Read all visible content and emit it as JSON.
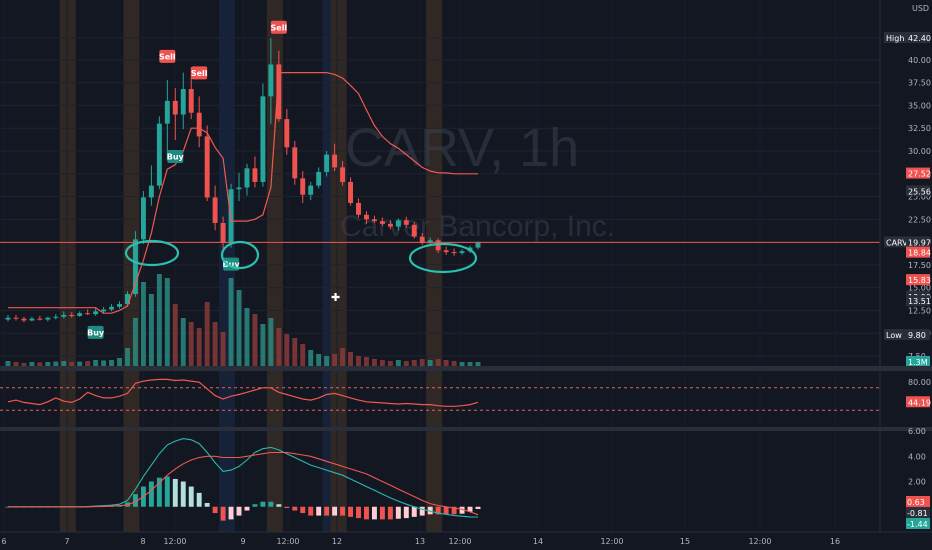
{
  "corner_label": "USD",
  "crosshair_glyph": "✚",
  "watermark": {
    "title": "CARV, 1h",
    "subtitle": "Carver Bancorp, Inc."
  },
  "colors": {
    "background": "#131722",
    "up": "#26a69a",
    "down": "#ef5350",
    "volume_up": "#2a8a80",
    "volume_down": "#8a3a38",
    "supertrend": "#f0584f",
    "rsi": "#f0584f",
    "macd": "#2ab7b0",
    "signal": "#f0584f",
    "hist_up_strong": "#26a69a",
    "hist_up_weak": "#b2dfdb",
    "hist_down_strong": "#ef5350",
    "hist_down_weak": "#ffcdd2",
    "annotation": "#2bbfae",
    "session_orange": "#f59c3a",
    "session_blue": "#2d6bd1"
  },
  "price_axis_labels": [
    "42.40",
    "40.00",
    "37.50",
    "35.00",
    "32.50",
    "30.00",
    "27.50",
    "25.00",
    "22.50",
    "20.00",
    "17.50",
    "15.00",
    "12.50",
    "10.00",
    "7.50"
  ],
  "price_tags": [
    {
      "text": "High",
      "value": "42.40",
      "style": "dark"
    },
    {
      "text": "",
      "value": "27.52",
      "style": "red"
    },
    {
      "text": "",
      "value": "25.56",
      "style": "dark"
    },
    {
      "text": "CARV",
      "value": "19.97",
      "style": "dark"
    },
    {
      "text": "",
      "value": "18.84",
      "style": "red"
    },
    {
      "text": "",
      "value": "15.83",
      "style": "red"
    },
    {
      "text": "",
      "value": "13.99",
      "style": "dark"
    },
    {
      "text": "",
      "value": "13.51",
      "style": "dark"
    },
    {
      "text": "Low",
      "value": "9.80",
      "style": "dark"
    },
    {
      "text": "",
      "value": "1.3M",
      "style": "teal"
    }
  ],
  "rsi_axis_labels": [
    "80.00"
  ],
  "rsi_tag": "44.19",
  "macd_axis_labels": [
    "6.00",
    "4.00",
    "2.00"
  ],
  "macd_tags": [
    {
      "value": "0.63",
      "style": "red"
    },
    {
      "value": "-0.81",
      "style": "dark"
    },
    {
      "value": "-1.44",
      "style": "teal"
    }
  ],
  "time_axis_labels": [
    "6",
    "7",
    "8",
    "12:00",
    "9",
    "12:00",
    "12",
    "13",
    "12:00",
    "14",
    "12:00",
    "15",
    "12:00",
    "16"
  ],
  "signals": [
    {
      "type": "Sell",
      "bar": 20
    },
    {
      "type": "Sell",
      "bar": 24
    },
    {
      "type": "Sell",
      "bar": 34
    },
    {
      "type": "Buy",
      "bar": 11
    },
    {
      "type": "Buy",
      "bar": 21
    },
    {
      "type": "Buy",
      "bar": 28
    }
  ],
  "chart_data": [
    {
      "type": "candlestick",
      "title": "CARV, 1h",
      "subtitle": "Carver Bancorp, Inc.",
      "currency": "USD",
      "ylim": [
        7.5,
        42.4
      ],
      "x": [
        "6",
        "7",
        "8",
        "12:00",
        "9",
        "12:00",
        "12",
        "13",
        "12:00",
        "14",
        "12:00",
        "15",
        "12:00",
        "16"
      ],
      "ohlc": [
        [
          11.5,
          12.0,
          11.3,
          11.7
        ],
        [
          11.7,
          12.0,
          11.4,
          11.6
        ],
        [
          11.6,
          11.8,
          11.2,
          11.4
        ],
        [
          11.4,
          11.8,
          11.3,
          11.6
        ],
        [
          11.6,
          11.9,
          11.4,
          11.5
        ],
        [
          11.5,
          11.8,
          11.3,
          11.7
        ],
        [
          11.7,
          12.1,
          11.5,
          11.8
        ],
        [
          11.8,
          12.4,
          11.6,
          12.0
        ],
        [
          12.0,
          12.3,
          11.7,
          11.9
        ],
        [
          11.9,
          12.4,
          11.8,
          12.2
        ],
        [
          12.2,
          12.6,
          12.0,
          12.1
        ],
        [
          12.1,
          12.8,
          11.9,
          12.4
        ],
        [
          12.4,
          12.9,
          12.1,
          12.6
        ],
        [
          12.6,
          13.2,
          12.4,
          12.9
        ],
        [
          12.9,
          13.5,
          12.7,
          13.2
        ],
        [
          13.2,
          14.6,
          12.9,
          14.3
        ],
        [
          14.3,
          21.2,
          14.0,
          20.3
        ],
        [
          20.3,
          25.6,
          19.8,
          24.9
        ],
        [
          24.9,
          28.4,
          24.0,
          26.2
        ],
        [
          26.2,
          33.8,
          25.8,
          33.0
        ],
        [
          33.0,
          37.8,
          29.0,
          35.5
        ],
        [
          35.5,
          36.9,
          31.2,
          34.0
        ],
        [
          34.0,
          38.6,
          32.4,
          36.8
        ],
        [
          36.8,
          39.2,
          33.5,
          34.2
        ],
        [
          34.2,
          36.0,
          30.4,
          31.6
        ],
        [
          31.6,
          32.8,
          24.5,
          24.9
        ],
        [
          24.9,
          26.2,
          21.3,
          22.1
        ],
        [
          22.1,
          22.8,
          19.3,
          19.9
        ],
        [
          19.9,
          26.4,
          19.4,
          25.8
        ],
        [
          25.8,
          27.6,
          24.5,
          26.0
        ],
        [
          26.0,
          28.6,
          25.1,
          28.1
        ],
        [
          28.1,
          29.4,
          26.0,
          26.6
        ],
        [
          26.6,
          37.4,
          26.1,
          36.0
        ],
        [
          36.0,
          42.4,
          33.0,
          39.5
        ],
        [
          39.5,
          41.0,
          33.2,
          33.5
        ],
        [
          33.5,
          34.6,
          29.6,
          30.4
        ],
        [
          30.4,
          31.1,
          26.3,
          27.0
        ],
        [
          27.0,
          27.8,
          24.3,
          25.2
        ],
        [
          25.2,
          26.6,
          24.6,
          26.2
        ],
        [
          26.2,
          28.2,
          25.9,
          27.7
        ],
        [
          27.7,
          30.0,
          27.2,
          29.6
        ],
        [
          29.6,
          30.8,
          27.8,
          28.2
        ],
        [
          28.2,
          28.9,
          26.2,
          26.6
        ],
        [
          26.6,
          27.1,
          24.0,
          24.3
        ],
        [
          24.3,
          24.8,
          22.7,
          23.0
        ],
        [
          23.0,
          23.4,
          22.0,
          22.5
        ],
        [
          22.5,
          22.9,
          22.1,
          22.3
        ],
        [
          22.3,
          22.7,
          21.8,
          22.0
        ],
        [
          22.0,
          22.4,
          21.4,
          21.7
        ],
        [
          21.7,
          22.6,
          21.3,
          22.4
        ],
        [
          22.4,
          22.8,
          21.6,
          21.9
        ],
        [
          21.9,
          22.2,
          20.4,
          20.6
        ],
        [
          20.6,
          21.0,
          19.7,
          19.9
        ],
        [
          19.9,
          20.5,
          19.6,
          20.2
        ],
        [
          20.2,
          20.4,
          18.8,
          19.1
        ],
        [
          19.1,
          19.5,
          18.6,
          18.9
        ],
        [
          18.9,
          19.3,
          18.5,
          18.8
        ],
        [
          18.8,
          19.2,
          18.6,
          19.0
        ],
        [
          19.0,
          19.6,
          18.8,
          19.4
        ],
        [
          19.4,
          20.1,
          19.2,
          19.97
        ]
      ],
      "volume": [
        0.25,
        0.2,
        0.15,
        0.2,
        0.18,
        0.2,
        0.22,
        0.25,
        0.2,
        0.22,
        0.25,
        0.3,
        0.28,
        0.3,
        0.4,
        0.9,
        2.4,
        4.2,
        3.6,
        4.6,
        4.4,
        3.1,
        2.4,
        2.2,
        1.9,
        3.2,
        2.2,
        1.7,
        4.4,
        3.8,
        2.9,
        2.6,
        2.1,
        2.4,
        1.9,
        1.6,
        1.4,
        1.1,
        0.8,
        0.6,
        0.5,
        0.6,
        0.9,
        0.7,
        0.5,
        0.45,
        0.35,
        0.3,
        0.25,
        0.3,
        0.25,
        0.3,
        0.35,
        0.3,
        0.35,
        0.3,
        0.25,
        0.2,
        0.2,
        0.2
      ],
      "volume_last": "1.3M",
      "supertrend": [
        12.8,
        12.8,
        12.8,
        12.8,
        12.8,
        12.8,
        12.8,
        12.8,
        12.8,
        12.8,
        12.8,
        12.8,
        12.2,
        12.2,
        12.5,
        13.0,
        15.5,
        18.0,
        21.0,
        25.0,
        28.0,
        28.5,
        30.0,
        32.5,
        32.5,
        32.0,
        30.4,
        29.2,
        22.3,
        22.3,
        22.3,
        22.5,
        23.0,
        26.0,
        38.6,
        38.6,
        38.6,
        38.6,
        38.6,
        38.6,
        38.6,
        38.4,
        38.0,
        37.2,
        36.3,
        34.5,
        32.8,
        31.6,
        30.8,
        30.3,
        29.6,
        28.9,
        28.2,
        27.8,
        27.6,
        27.6,
        27.5,
        27.5,
        27.5,
        27.5
      ]
    },
    {
      "type": "line",
      "name": "RSI",
      "ylim": [
        0,
        100
      ],
      "values": [
        45,
        48,
        44,
        42,
        40,
        45,
        52,
        46,
        44,
        50,
        62,
        56,
        52,
        52,
        55,
        60,
        78,
        82,
        84,
        85,
        85,
        83,
        84,
        82,
        80,
        68,
        56,
        50,
        55,
        58,
        62,
        66,
        70,
        70,
        62,
        58,
        54,
        50,
        48,
        52,
        58,
        60,
        56,
        52,
        48,
        45,
        44,
        43,
        42,
        41,
        42,
        41,
        40,
        40,
        38,
        37,
        37,
        38,
        40,
        44.19
      ]
    },
    {
      "type": "bar",
      "name": "MACD",
      "ylim": [
        -2.0,
        6.0
      ],
      "macd": [
        0.0,
        0.0,
        0.0,
        0.0,
        0.0,
        0.0,
        0.0,
        0.0,
        0.0,
        0.0,
        0.02,
        0.05,
        0.08,
        0.12,
        0.2,
        0.5,
        1.4,
        2.4,
        3.3,
        4.2,
        4.9,
        5.2,
        5.4,
        5.3,
        5.0,
        4.3,
        3.5,
        2.8,
        2.9,
        3.2,
        3.7,
        4.3,
        4.6,
        4.7,
        4.5,
        4.2,
        3.9,
        3.6,
        3.3,
        3.1,
        2.9,
        2.7,
        2.5,
        2.2,
        1.9,
        1.6,
        1.3,
        1.0,
        0.7,
        0.45,
        0.2,
        0.0,
        -0.2,
        -0.35,
        -0.5,
        -0.6,
        -0.7,
        -0.75,
        -0.8,
        -0.81
      ],
      "signal": [
        0.0,
        0.0,
        0.0,
        0.0,
        0.0,
        0.0,
        0.0,
        0.0,
        0.0,
        0.0,
        0.0,
        0.01,
        0.03,
        0.05,
        0.08,
        0.15,
        0.4,
        0.8,
        1.3,
        1.9,
        2.5,
        3.0,
        3.4,
        3.7,
        3.9,
        4.0,
        4.0,
        3.9,
        3.9,
        3.9,
        4.0,
        4.1,
        4.2,
        4.3,
        4.3,
        4.3,
        4.2,
        4.1,
        4.0,
        3.8,
        3.6,
        3.4,
        3.2,
        3.0,
        2.8,
        2.6,
        2.3,
        2.0,
        1.7,
        1.4,
        1.1,
        0.8,
        0.5,
        0.25,
        0.1,
        0.0,
        -0.1,
        -0.2,
        -0.4,
        -0.63
      ],
      "histogram_last": "-0.81"
    }
  ]
}
